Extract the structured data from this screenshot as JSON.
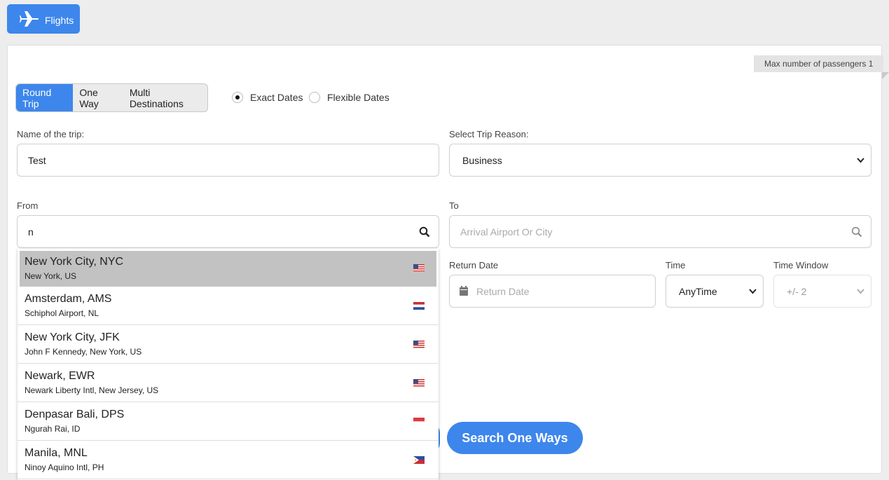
{
  "top_tab": {
    "label": "Flights",
    "icon": "plane-icon"
  },
  "max_passengers": {
    "text": "Max number of passengers 1"
  },
  "trip_types": [
    {
      "label": "Round Trip",
      "active": true
    },
    {
      "label": "One Way",
      "active": false
    },
    {
      "label": "Multi Destinations",
      "active": false
    }
  ],
  "date_mode": [
    {
      "label": "Exact Dates",
      "checked": true
    },
    {
      "label": "Flexible Dates",
      "checked": false
    }
  ],
  "trip_name": {
    "label": "Name of the trip:",
    "value": "Test"
  },
  "trip_reason": {
    "label": "Select Trip Reason:",
    "value": "Business"
  },
  "from": {
    "label": "From",
    "value": "n",
    "icon": "search-icon"
  },
  "to": {
    "label": "To",
    "placeholder": "Arrival Airport Or City",
    "icon": "search-icon"
  },
  "return_date": {
    "label": "Return Date",
    "placeholder": "Return Date",
    "icon": "calendar-icon"
  },
  "time": {
    "label": "Time",
    "value": "AnyTime"
  },
  "time_window": {
    "label": "Time Window",
    "value": "+/- 2"
  },
  "suggestions": [
    {
      "title": "New York City, NYC",
      "sub": "New York, US",
      "flag": "us"
    },
    {
      "title": "Amsterdam, AMS",
      "sub": "Schiphol Airport, NL",
      "flag": "nl"
    },
    {
      "title": "New York City, JFK",
      "sub": "John F Kennedy, New York, US",
      "flag": "us"
    },
    {
      "title": "Newark, EWR",
      "sub": "Newark Liberty Intl, New Jersey, US",
      "flag": "us"
    },
    {
      "title": "Denpasar Bali, DPS",
      "sub": "Ngurah Rai, ID",
      "flag": "id"
    },
    {
      "title": "Manila, MNL",
      "sub": "Ninoy Aquino Intl, PH",
      "flag": "ph"
    }
  ],
  "search_button": {
    "label": "Search One Ways"
  },
  "colors": {
    "accent": "#3d86ec",
    "highlight": "#c2c2c2"
  }
}
